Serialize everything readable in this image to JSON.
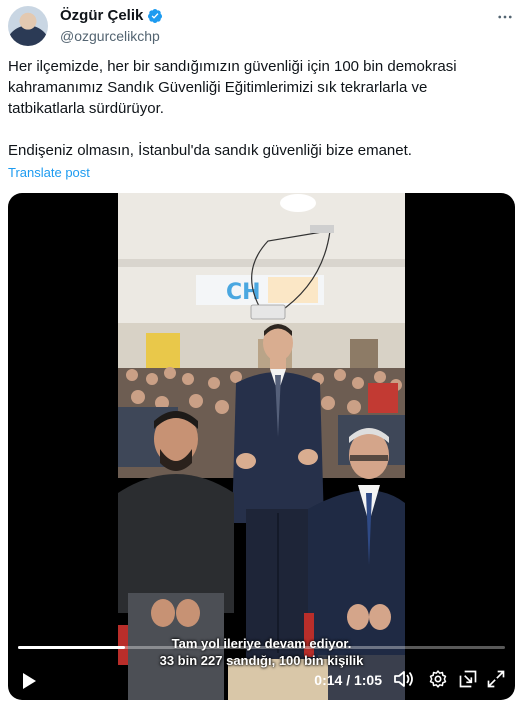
{
  "author": {
    "display_name": "Özgür Çelik",
    "handle": "@ozgurcelikchp",
    "verified_icon": "verified-badge-icon",
    "more_icon": "more-options-icon"
  },
  "post": {
    "paragraph_1": "Her ilçemizde, her bir sandığımızın güvenliği için 100 bin demokrasi kahramanımız Sandık Güvenliği Eğitimlerimizi sık tekrarlarla ve tatbikatlarla sürdürüyor.",
    "paragraph_2": "Endişeniz olmasın, İstanbul'da sandık güvenliği bize emanet.",
    "translate_label": "Translate post"
  },
  "video": {
    "subtitle_line_1": "Tam yol ileriye devam ediyor.",
    "subtitle_line_2": "33 bin 227 sandığı, 100 bin kişilik",
    "time_display": "0:14 / 1:05",
    "progress_fraction": 0.22,
    "icons": [
      "play-icon",
      "volume-icon",
      "settings-icon",
      "picture-in-picture-icon",
      "fullscreen-icon"
    ]
  },
  "colors": {
    "text_primary": "#0f1419",
    "text_secondary": "#536471",
    "link_blue": "#1d9bf0",
    "verified_blue": "#1d9bf0"
  }
}
